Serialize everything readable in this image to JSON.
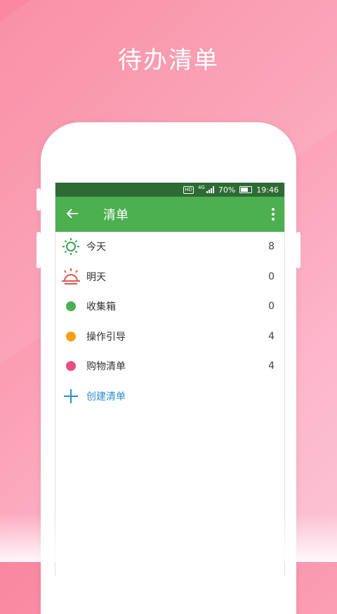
{
  "promo": {
    "title": "待办清单"
  },
  "status_bar": {
    "hd": "HD",
    "network": "4G",
    "battery": "70%",
    "time": "19:46"
  },
  "appbar": {
    "title": "清单",
    "back_icon": "arrow-left-icon",
    "menu_icon": "more-vertical-icon"
  },
  "lists": [
    {
      "label": "今天",
      "count": "8",
      "icon": "sun-icon",
      "color": "#3aa150"
    },
    {
      "label": "明天",
      "count": "0",
      "icon": "sunrise-icon",
      "color": "#e0574f"
    },
    {
      "label": "收集箱",
      "count": "0",
      "icon": "dot-icon",
      "color": "#4caf50"
    },
    {
      "label": "操作引导",
      "count": "4",
      "icon": "dot-icon",
      "color": "#f5a01a"
    },
    {
      "label": "购物清单",
      "count": "4",
      "icon": "dot-icon",
      "color": "#ec4c82"
    }
  ],
  "create_list": {
    "label": "创建清单",
    "icon": "plus-icon",
    "color": "#2a8fce"
  },
  "colors": {
    "statusbar": "#2e6a33",
    "appbar": "#4caf50",
    "background": "#fb9fb5"
  }
}
